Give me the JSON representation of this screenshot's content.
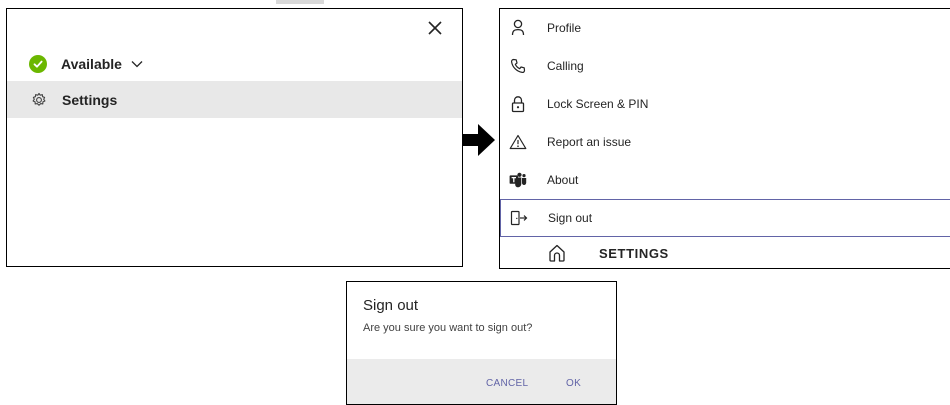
{
  "status": {
    "label": "Available",
    "color": "#6bb700"
  },
  "left_menu": {
    "settings_label": "Settings"
  },
  "settings_menu": {
    "items": [
      {
        "label": "Profile",
        "icon": "profile-icon"
      },
      {
        "label": "Calling",
        "icon": "phone-icon"
      },
      {
        "label": "Lock Screen & PIN",
        "icon": "lock-icon"
      },
      {
        "label": "Report an issue",
        "icon": "warning-icon"
      },
      {
        "label": "About",
        "icon": "teams-icon"
      },
      {
        "label": "Sign out",
        "icon": "sign-out-icon"
      }
    ],
    "bottom_title": "SETTINGS"
  },
  "dialog": {
    "title": "Sign out",
    "message": "Are you sure you want to sign out?",
    "cancel_label": "CANCEL",
    "ok_label": "OK"
  },
  "colors": {
    "accent": "#6264a7",
    "selected_row": "#e8e8e8",
    "dialog_footer": "#ebebeb"
  }
}
